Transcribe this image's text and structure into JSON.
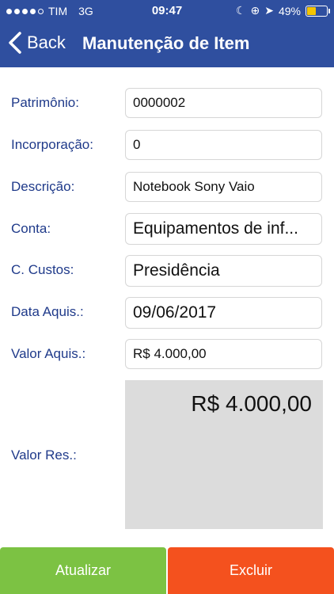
{
  "status": {
    "carrier": "TIM",
    "network": "3G",
    "time": "09:47",
    "battery": "49%",
    "battery_level": 0.49
  },
  "nav": {
    "back_label": "Back",
    "title": "Manutenção de Item"
  },
  "form": {
    "patrimonio": {
      "label": "Patrimônio:",
      "value": "0000002"
    },
    "incorporacao": {
      "label": "Incorporação:",
      "value": "0"
    },
    "descricao": {
      "label": "Descrição:",
      "value": "Notebook Sony Vaio"
    },
    "conta": {
      "label": "Conta:",
      "value": "Equipamentos de inf..."
    },
    "custos": {
      "label": "C. Custos:",
      "value": "Presidência"
    },
    "data_aquis": {
      "label": "Data Aquis.:",
      "value": "09/06/2017"
    },
    "valor_aquis": {
      "label": "Valor Aquis.:",
      "value": "R$ 4.000,00"
    },
    "valor_res": {
      "label": "Valor Res.:",
      "value": "R$ 4.000,00"
    }
  },
  "actions": {
    "update_label": "Atualizar",
    "delete_label": "Excluir"
  },
  "colors": {
    "header": "#2f4f9f",
    "label": "#1f3a8a",
    "update": "#7cc243",
    "delete": "#f4511e"
  }
}
